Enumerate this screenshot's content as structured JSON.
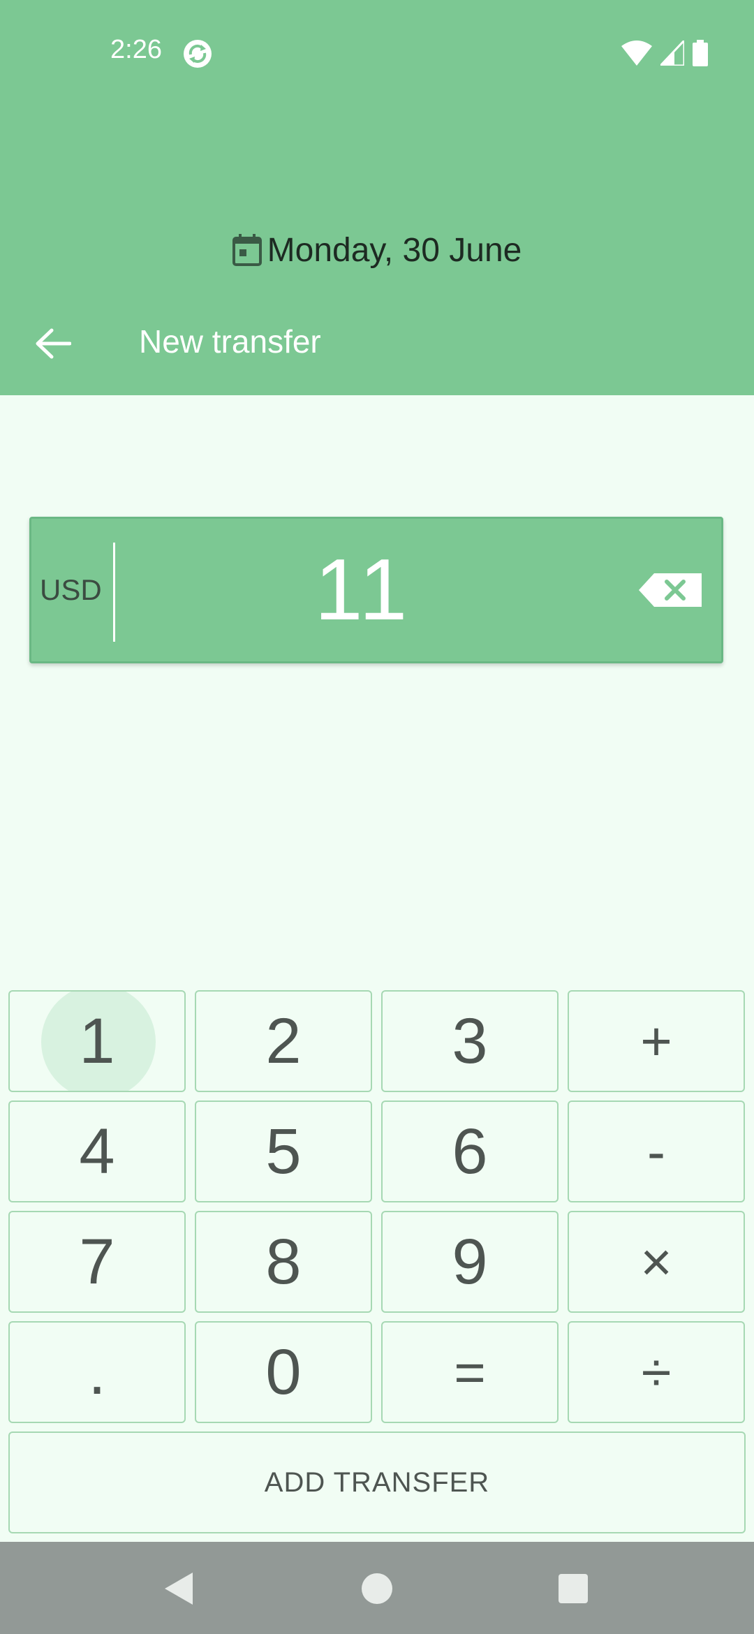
{
  "status_bar": {
    "time": "2:26",
    "icons": [
      "sync-icon",
      "wifi-icon",
      "signal-icon",
      "battery-icon"
    ]
  },
  "header": {
    "date": "Monday, 30 June",
    "date_icon": "calendar-icon",
    "back_icon": "arrow-back-icon",
    "title": "New transfer"
  },
  "amount": {
    "currency": "USD",
    "value": "11",
    "backspace_icon": "backspace-icon"
  },
  "keypad": {
    "k1": "1",
    "k2": "2",
    "k3": "3",
    "plus": "+",
    "k4": "4",
    "k5": "5",
    "k6": "6",
    "minus": "-",
    "k7": "7",
    "k8": "8",
    "k9": "9",
    "times": "×",
    "dot": ".",
    "k0": "0",
    "equals": "=",
    "divide": "÷"
  },
  "actions": {
    "add_transfer": "ADD TRANSFER"
  },
  "nav_bar": {
    "icons": [
      "back-triangle-icon",
      "home-circle-icon",
      "recents-square-icon"
    ]
  },
  "colors": {
    "header_bg": "#7cc893",
    "page_bg": "#f1fdf4",
    "key_border": "#a6d8b3",
    "nav_bg": "#929996"
  }
}
